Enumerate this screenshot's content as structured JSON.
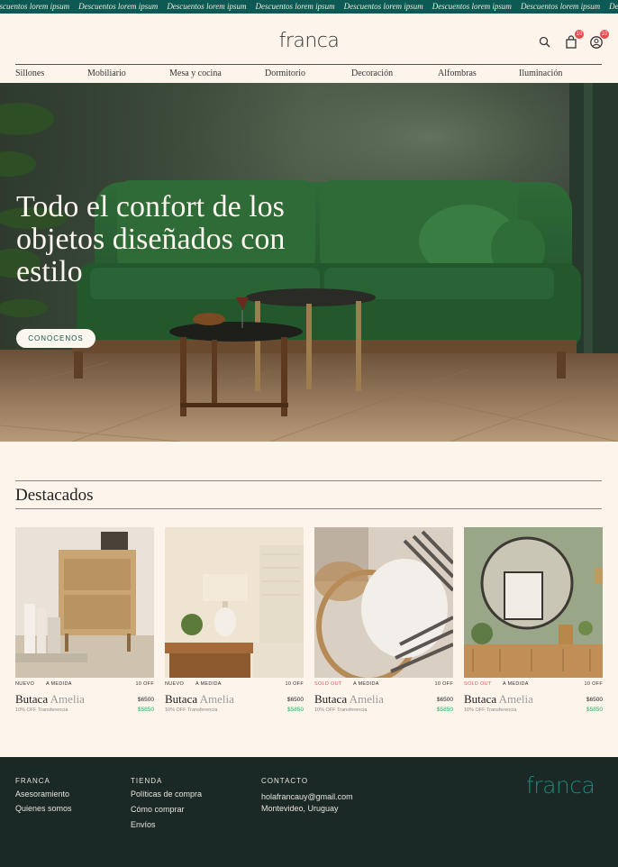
{
  "ticker": {
    "items": [
      "Descuentos lorem ipsum",
      "Descuentos lorem ipsum",
      "Descuentos lorem ipsum",
      "Descuentos lorem ipsum",
      "Descuentos lorem ipsum",
      "Descuentos lorem ipsum",
      "Descuentos lorem ipsum",
      "Descuentos lorem ipsum"
    ]
  },
  "header": {
    "logo": "franca",
    "cart_badge": "10",
    "account_badge": "10",
    "icons": [
      "search-icon",
      "shopping-bag-icon",
      "user-icon"
    ]
  },
  "nav": {
    "items": [
      "Sillones",
      "Mobiliario",
      "Mesa y cocina",
      "Dormitorio",
      "Decoración",
      "Alfombras",
      "Iluminación"
    ]
  },
  "hero": {
    "title": "Todo el confort de los objetos diseñados con estilo",
    "cta": "CONOCENOS"
  },
  "featured": {
    "title": "Destacados",
    "products": [
      {
        "tag": "NUEVO",
        "tag_status": "new",
        "tag2": "A MEDIDA",
        "discount": "10 OFF",
        "name": "Butaca",
        "name_light": "Amelia",
        "price": "$6500",
        "promo": "10% OFF Transferencia",
        "sale_price": "$5850"
      },
      {
        "tag": "NUEVO",
        "tag_status": "new",
        "tag2": "A MEDIDA",
        "discount": "10 OFF",
        "name": "Butaca",
        "name_light": "Amelia",
        "price": "$6500",
        "promo": "10% OFF Transferencia",
        "sale_price": "$5850"
      },
      {
        "tag": "SOLD OUT",
        "tag_status": "sold",
        "tag2": "A MEDIDA",
        "discount": "10 OFF",
        "name": "Butaca",
        "name_light": "Amelia",
        "price": "$6500",
        "promo": "10% OFF Transferencia",
        "sale_price": "$5850"
      },
      {
        "tag": "SOLD OUT",
        "tag_status": "sold",
        "tag2": "A MEDIDA",
        "discount": "10 OFF",
        "name": "Butaca",
        "name_light": "Amelia",
        "price": "$6500",
        "promo": "10% OFF Transferencia",
        "sale_price": "$5850"
      }
    ]
  },
  "footer": {
    "col1": {
      "heading": "FRANCA",
      "links": [
        "Asesoramiento",
        "Quienes somos"
      ]
    },
    "col2": {
      "heading": "TIENDA",
      "links": [
        "Políticas de compra",
        "Cómo comprar",
        "Envíos"
      ]
    },
    "col3": {
      "heading": "CONTACTO",
      "lines": [
        "holafrancauy@gmail.com",
        "Montevideo, Uruguay"
      ]
    },
    "logo": "franca"
  },
  "colors": {
    "ticker_bg": "#0d5a54",
    "page_bg": "#fdf5ec",
    "footer_bg": "#1a2826",
    "accent_teal": "#1a8a7a",
    "sold_out": "#e25555",
    "sale_green": "#2eaa63",
    "badge": "#ec4a4a"
  }
}
